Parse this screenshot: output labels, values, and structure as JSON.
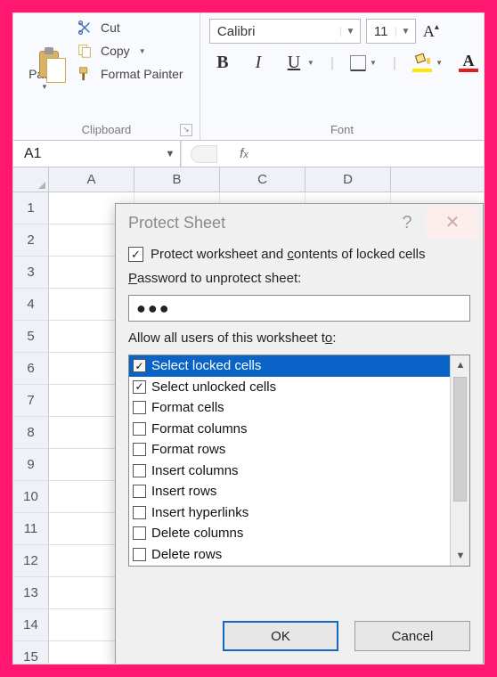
{
  "ribbon": {
    "clipboard": {
      "title": "Clipboard",
      "paste": "Paste",
      "cut": "Cut",
      "copy": "Copy",
      "format_painter": "Format Painter"
    },
    "font": {
      "title": "Font",
      "family": "Calibri",
      "size": "11"
    }
  },
  "namebox": "A1",
  "formula": "",
  "columns": [
    "A",
    "B",
    "C",
    "D"
  ],
  "rows": [
    "1",
    "2",
    "3",
    "4",
    "5",
    "6",
    "7",
    "8",
    "9",
    "10",
    "11",
    "12",
    "13",
    "14",
    "15"
  ],
  "dialog": {
    "title": "Protect Sheet",
    "protect_label": "Protect worksheet and contents of locked cells",
    "protect_checked": true,
    "password_label": "Password to unprotect sheet:",
    "password_value": "●●●",
    "allow_label": "Allow all users of this worksheet to:",
    "options": [
      {
        "label": "Select locked cells",
        "checked": true,
        "selected": true
      },
      {
        "label": "Select unlocked cells",
        "checked": true,
        "selected": false
      },
      {
        "label": "Format cells",
        "checked": false,
        "selected": false
      },
      {
        "label": "Format columns",
        "checked": false,
        "selected": false
      },
      {
        "label": "Format rows",
        "checked": false,
        "selected": false
      },
      {
        "label": "Insert columns",
        "checked": false,
        "selected": false
      },
      {
        "label": "Insert rows",
        "checked": false,
        "selected": false
      },
      {
        "label": "Insert hyperlinks",
        "checked": false,
        "selected": false
      },
      {
        "label": "Delete columns",
        "checked": false,
        "selected": false
      },
      {
        "label": "Delete rows",
        "checked": false,
        "selected": false
      }
    ],
    "ok": "OK",
    "cancel": "Cancel"
  }
}
